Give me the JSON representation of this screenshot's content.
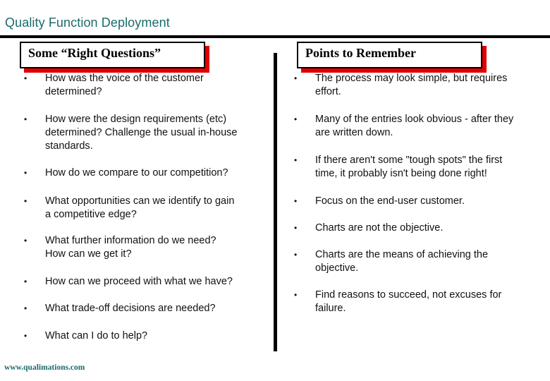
{
  "title": "Quality Function Deployment",
  "left_section": {
    "heading": "Some “Right Questions”",
    "bullet_glyph": "•",
    "items": [
      {
        "lines": [
          "How was the voice of the customer",
          "determined?"
        ]
      },
      {
        "lines": [
          "How were the design requirements (etc)",
          "determined?  Challenge the usual in-house",
          "standards."
        ]
      },
      {
        "lines": [
          "How do we compare to our competition?"
        ]
      },
      {
        "lines": [
          "What opportunities can we identify to gain",
          "a competitive edge?"
        ]
      },
      {
        "lines": [
          "What further information do we need?",
          "How can we get it?"
        ]
      },
      {
        "lines": [
          "How can we proceed with what we have?"
        ]
      },
      {
        "lines": [
          "What trade-off decisions are needed?"
        ]
      },
      {
        "lines": [
          "What can I do to help?"
        ]
      }
    ]
  },
  "right_section": {
    "heading": "Points to Remember",
    "bullet_glyph": "•",
    "items": [
      {
        "lines": [
          "The process may look simple, but requires",
          "effort."
        ]
      },
      {
        "lines": [
          "Many of the entries look obvious - after they",
          "are written down."
        ]
      },
      {
        "lines": [
          "If there aren't some \"tough spots\" the first",
          "time, it probably isn't being done right!"
        ]
      },
      {
        "lines": [
          "Focus on the end-user customer."
        ]
      },
      {
        "lines": [
          "Charts are not the objective."
        ]
      },
      {
        "lines": [
          "Charts are the means of achieving the",
          "objective."
        ]
      },
      {
        "lines": [
          "Find reasons to succeed, not excuses for",
          "failure."
        ]
      }
    ]
  },
  "footer": "www.qualimations.com",
  "colors": {
    "title": "#1a6b6b",
    "accent_shadow": "#e00000"
  }
}
